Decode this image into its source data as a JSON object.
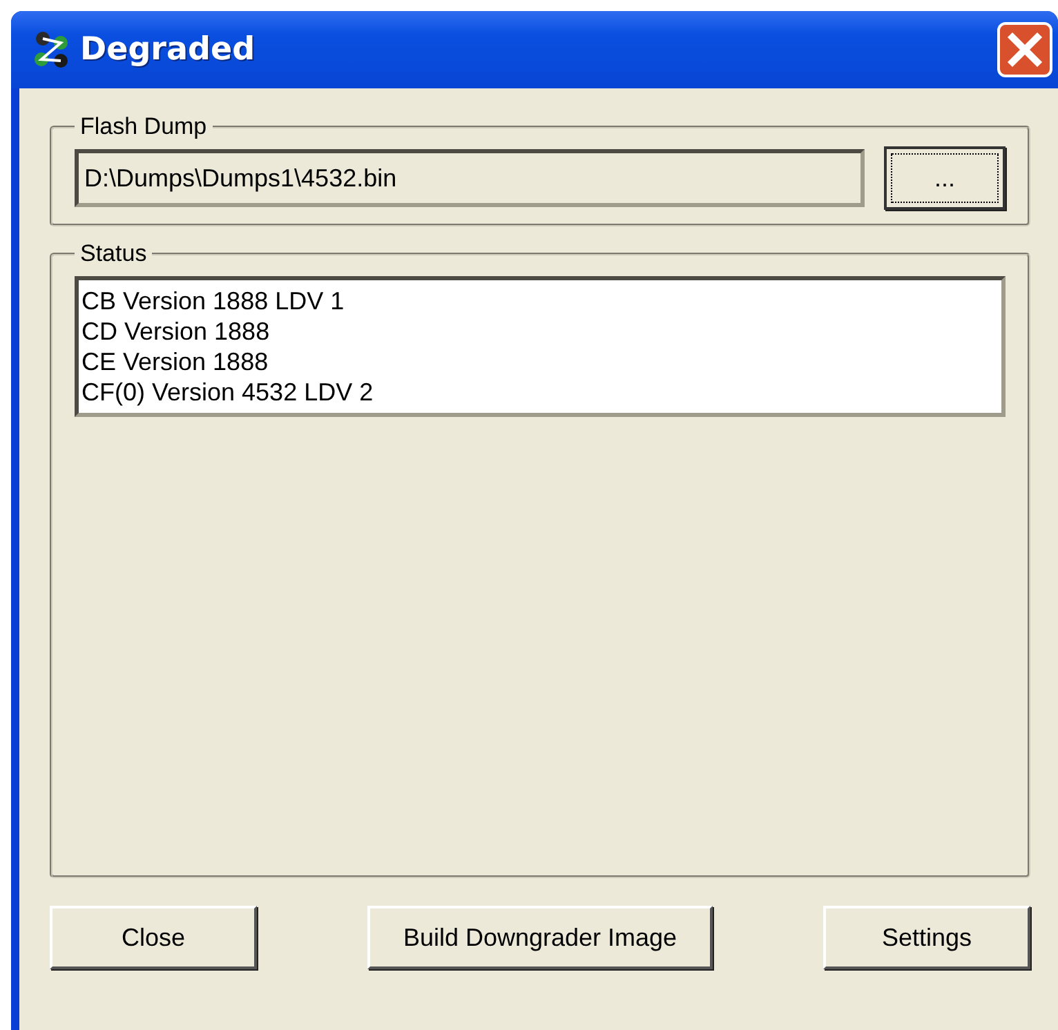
{
  "window": {
    "title": "Degraded"
  },
  "flash_dump": {
    "label": "Flash Dump",
    "path": "D:\\Dumps\\Dumps1\\4532.bin",
    "browse_button": "..."
  },
  "status": {
    "label": "Status",
    "lines": [
      "CB Version 1888 LDV 1",
      "CD Version 1888",
      "CE Version 1888",
      "CF(0) Version 4532 LDV 2"
    ]
  },
  "buttons": [
    "Close",
    "Build Downgrader Image",
    "Settings"
  ]
}
